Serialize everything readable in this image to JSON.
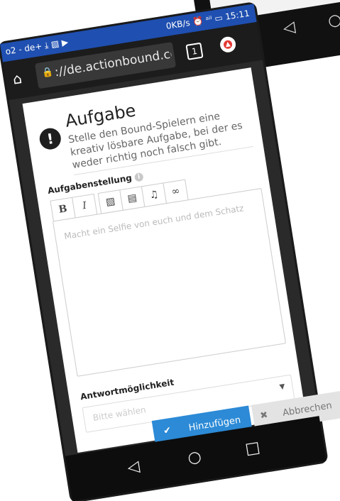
{
  "status_bar": {
    "carrier": "o2 - de+ ⤓ ▧ ▶",
    "right_text": "0KB/s ⏰ ᵃⁱˡ ▭ 15:11"
  },
  "browser": {
    "url": "://de.actionbound.com/(",
    "tab_count": "1"
  },
  "task": {
    "title": "Aufgabe",
    "description": "Stelle den Bound-Spielern eine kreativ lösbare Aufgabe, bei der es weder richtig noch falsch gibt."
  },
  "editor": {
    "label": "Aufgabenstellung",
    "placeholder": "Macht ein Selfie von euch und dem Schatz",
    "toolbar": {
      "bold": "B",
      "italic": "I"
    }
  },
  "answer": {
    "label": "Antwortmöglichkeit",
    "placeholder": "Bitte wählen"
  },
  "actions": {
    "add_label": "Hinzufügen",
    "cancel_label": "Abbrechen"
  },
  "colors": {
    "status_bar": "#1f4fb0",
    "primary_button": "#2c8ad6"
  }
}
